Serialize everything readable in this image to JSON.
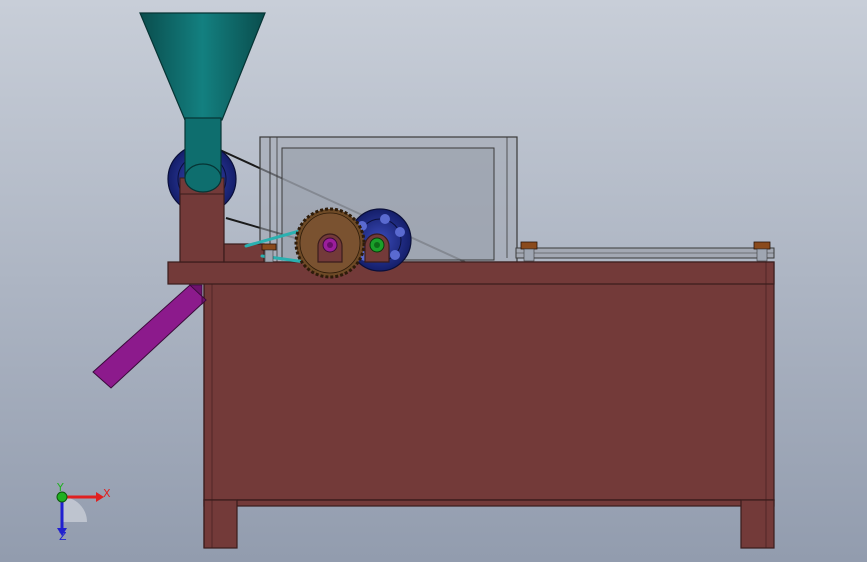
{
  "viewport": {
    "background_top": "#c8ced8",
    "background_bottom": "#929cae"
  },
  "colors": {
    "frame": "#733a39",
    "frame_edge": "#3a1c1c",
    "hopper": "#0e6e6e",
    "hopper_dark": "#0a4d4d",
    "chute": "#8c1a8c",
    "pulley_blue": "#1e2c8e",
    "gear_brown": "#6e4a26",
    "shaft_green": "#1aa02a",
    "shaft_purple": "#9b1e9b",
    "bolt": "#8a4a1c",
    "cover_glass": "#9aa0ac"
  },
  "triad": {
    "x_label": "X",
    "y_label": "Y",
    "z_label": "Z",
    "x_color": "#e02020",
    "y_color": "#20b020",
    "z_color": "#2020d0"
  }
}
